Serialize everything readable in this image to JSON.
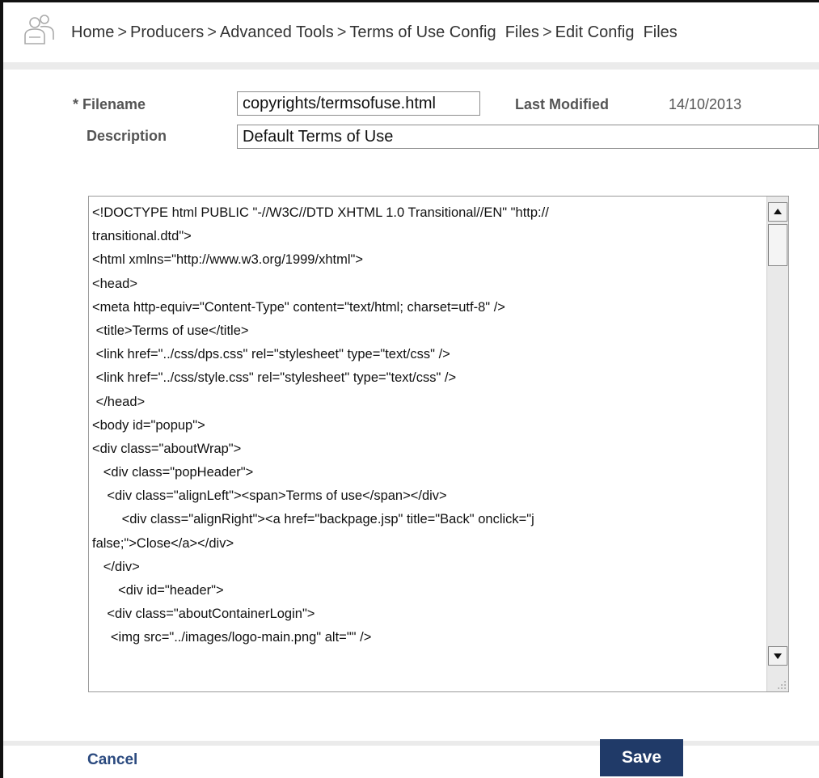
{
  "breadcrumb": {
    "items": [
      "Home",
      "Producers",
      "Advanced Tools",
      "Terms of Use Config  Files",
      "Edit Config  Files"
    ],
    "separator": ">"
  },
  "form": {
    "filename_label": "* Filename",
    "filename_value": "copyrights/termsofuse.html",
    "last_modified_label": "Last Modified",
    "last_modified_value": "14/10/2013",
    "description_label": "Description",
    "description_value": "Default Terms of Use"
  },
  "editor": {
    "lines": [
      "<!DOCTYPE html PUBLIC \"-//W3C//DTD XHTML 1.0 Transitional//EN\" \"http://",
      "transitional.dtd\">",
      "<html xmlns=\"http://www.w3.org/1999/xhtml\">",
      "<head>",
      "<meta http-equiv=\"Content-Type\" content=\"text/html; charset=utf-8\" />",
      " <title>Terms of use</title>",
      " <link href=\"../css/dps.css\" rel=\"stylesheet\" type=\"text/css\" />",
      " <link href=\"../css/style.css\" rel=\"stylesheet\" type=\"text/css\" />",
      " </head>",
      "<body id=\"popup\">",
      "<div class=\"aboutWrap\">",
      "   <div class=\"popHeader\">",
      "    <div class=\"alignLeft\"><span>Terms of use</span></div>",
      "        <div class=\"alignRight\"><a href=\"backpage.jsp\" title=\"Back\" onclick=\"j",
      "false;\">Close</a></div>",
      "   </div>",
      "       <div id=\"header\">",
      "    <div class=\"aboutContainerLogin\">",
      "     <img src=\"../images/logo-main.png\" alt=\"\" />"
    ]
  },
  "actions": {
    "cancel_label": "Cancel",
    "save_label": "Save"
  },
  "colors": {
    "save_bg": "#203a68",
    "cancel_text": "#2b4a7f",
    "separator": "#ebebeb"
  },
  "icons": {
    "logo": "users-icon",
    "scroll_up": "arrow-up-icon",
    "scroll_down": "arrow-down-icon",
    "resize": "resize-grip-icon"
  }
}
